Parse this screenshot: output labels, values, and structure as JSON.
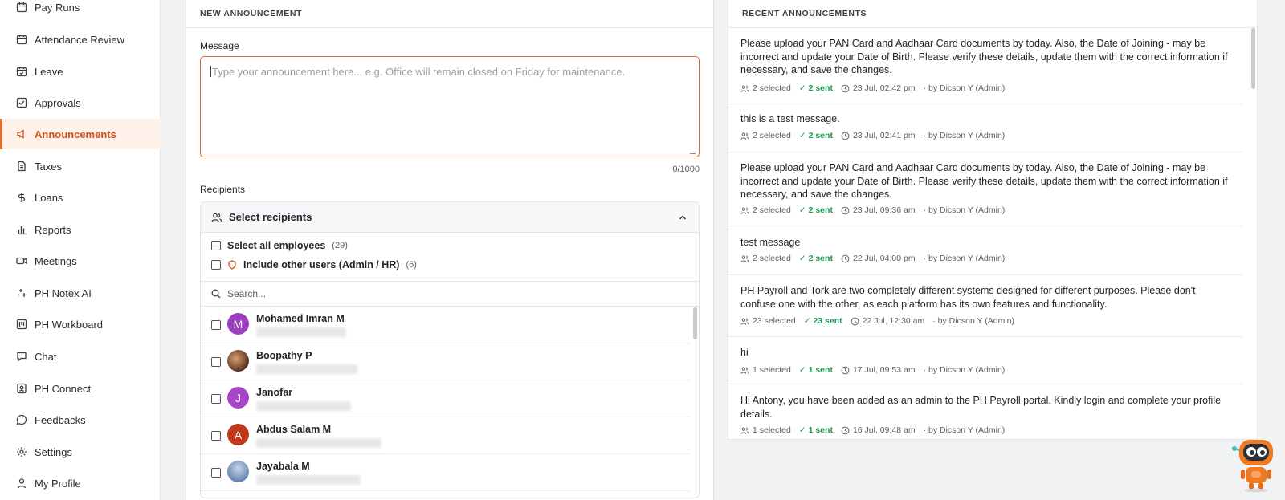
{
  "sidebar": {
    "items": [
      {
        "label": "Pay Runs",
        "icon": "calendar-icon"
      },
      {
        "label": "Attendance Review",
        "icon": "calendar-icon"
      },
      {
        "label": "Leave",
        "icon": "calendar-check-icon"
      },
      {
        "label": "Approvals",
        "icon": "check-square-icon"
      },
      {
        "label": "Announcements",
        "icon": "megaphone-icon",
        "active": true
      },
      {
        "label": "Taxes",
        "icon": "document-icon"
      },
      {
        "label": "Loans",
        "icon": "dollar-icon"
      },
      {
        "label": "Reports",
        "icon": "bar-chart-icon"
      },
      {
        "label": "Meetings",
        "icon": "video-icon"
      },
      {
        "label": "PH Notex AI",
        "icon": "sparkle-icon"
      },
      {
        "label": "PH Workboard",
        "icon": "board-icon"
      },
      {
        "label": "Chat",
        "icon": "chat-icon"
      },
      {
        "label": "PH Connect",
        "icon": "contact-icon"
      },
      {
        "label": "Feedbacks",
        "icon": "message-circle-icon"
      },
      {
        "label": "Settings",
        "icon": "gear-icon"
      },
      {
        "label": "My Profile",
        "icon": "user-icon"
      }
    ]
  },
  "new_announcement": {
    "title": "NEW ANNOUNCEMENT",
    "message_label": "Message",
    "message_placeholder": "Type your announcement here... e.g. Office will remain closed on Friday for maintenance.",
    "counter": "0/1000",
    "recipients_label": "Recipients",
    "select_recipients": "Select recipients",
    "select_all_label": "Select all employees",
    "select_all_count": "(29)",
    "include_other_label": "Include other users (Admin / HR)",
    "include_other_count": "(6)",
    "search_placeholder": "Search...",
    "employees": [
      {
        "name": "Mohamed Imran M",
        "initial": "M",
        "color": "#9c3fbf"
      },
      {
        "name": "Boopathy P",
        "initial": "",
        "color": "#6b4a3a"
      },
      {
        "name": "Janofar",
        "initial": "J",
        "color": "#a646c9"
      },
      {
        "name": "Abdus Salam M",
        "initial": "A",
        "color": "#c0391b"
      },
      {
        "name": "Jayabala M",
        "initial": "",
        "color": "#8aa6c8"
      }
    ]
  },
  "recent": {
    "title": "RECENT ANNOUNCEMENTS",
    "items": [
      {
        "text": "Please upload your PAN Card and Aadhaar Card documents by today. Also, the Date of Joining - may be incorrect and update your Date of Birth. Please verify these details, update them with the correct information if necessary, and save the changes.",
        "selected": "2 selected",
        "sent": "✓ 2 sent",
        "time": "23 Jul, 02:42 pm",
        "by": "· by Dicson Y (Admin)"
      },
      {
        "text": "this is a test message.",
        "selected": "2 selected",
        "sent": "✓ 2 sent",
        "time": "23 Jul, 02:41 pm",
        "by": "· by Dicson Y (Admin)"
      },
      {
        "text": "Please upload your PAN Card and Aadhaar Card documents by today. Also, the Date of Joining - may be incorrect and update your Date of Birth. Please verify these details, update them with the correct information if necessary, and save the changes.",
        "selected": "2 selected",
        "sent": "✓ 2 sent",
        "time": "23 Jul, 09:36 am",
        "by": "· by Dicson Y (Admin)"
      },
      {
        "text": "test message",
        "selected": "2 selected",
        "sent": "✓ 2 sent",
        "time": "22 Jul, 04:00 pm",
        "by": "· by Dicson Y (Admin)"
      },
      {
        "text": "PH Payroll and Tork are two completely different systems designed for different purposes. Please don't confuse one with the other, as each platform has its own features and functionality.",
        "selected": "23 selected",
        "sent": "✓ 23 sent",
        "time": "22 Jul, 12:30 am",
        "by": "· by Dicson Y (Admin)"
      },
      {
        "text": "hi",
        "selected": "1 selected",
        "sent": "✓ 1 sent",
        "time": "17 Jul, 09:53 am",
        "by": "· by Dicson Y (Admin)"
      },
      {
        "text": "Hi Antony, you have been added as an admin to the PH Payroll portal. Kindly login and complete your profile details.",
        "selected": "1 selected",
        "sent": "✓ 1 sent",
        "time": "16 Jul, 09:48 am",
        "by": "· by Dicson Y (Admin)"
      }
    ]
  },
  "colors": {
    "accent": "#e06a2f",
    "sent_green": "#1a9850"
  }
}
